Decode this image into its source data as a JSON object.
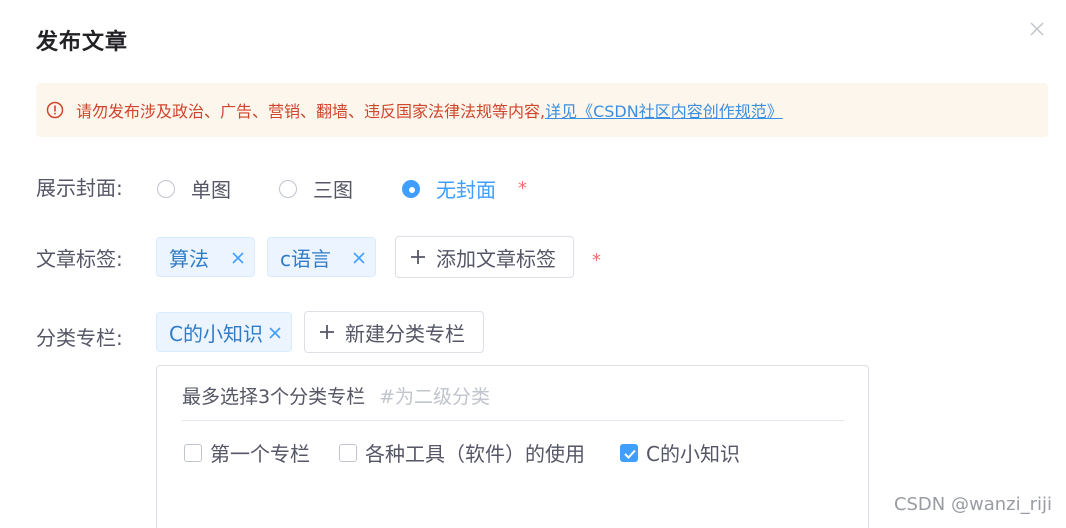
{
  "dialog": {
    "title": "发布文章",
    "alert": {
      "warning": "请勿发布涉及政治、广告、营销、翻墙、违反国家法律法规等内容,",
      "link": "详见《CSDN社区内容创作规范》"
    }
  },
  "cover": {
    "label": "展示封面:",
    "options": [
      "单图",
      "三图",
      "无封面"
    ],
    "selected": "无封面",
    "required_mark": "*"
  },
  "tags": {
    "label": "文章标签:",
    "items": [
      "算法",
      "c语言"
    ],
    "add_button": "添加文章标签",
    "required_mark": "*"
  },
  "category": {
    "label": "分类专栏:",
    "selected_tags": [
      "C的小知识"
    ],
    "new_button": "新建分类专栏",
    "panel": {
      "title": "最多选择3个分类专栏",
      "hint": "#为二级分类",
      "options": [
        {
          "label": "第一个专栏",
          "checked": false
        },
        {
          "label": "各种工具（软件）的使用",
          "checked": false
        },
        {
          "label": "C的小知识",
          "checked": true
        }
      ]
    }
  },
  "watermark": "CSDN @wanzi_riji",
  "colors": {
    "accent": "#409eff",
    "warning_text": "#d0452c",
    "alert_bg": "#fdf6ec",
    "required": "#f56c6c",
    "tag_bg": "#ecf5ff",
    "link": "#3b8ee0"
  }
}
